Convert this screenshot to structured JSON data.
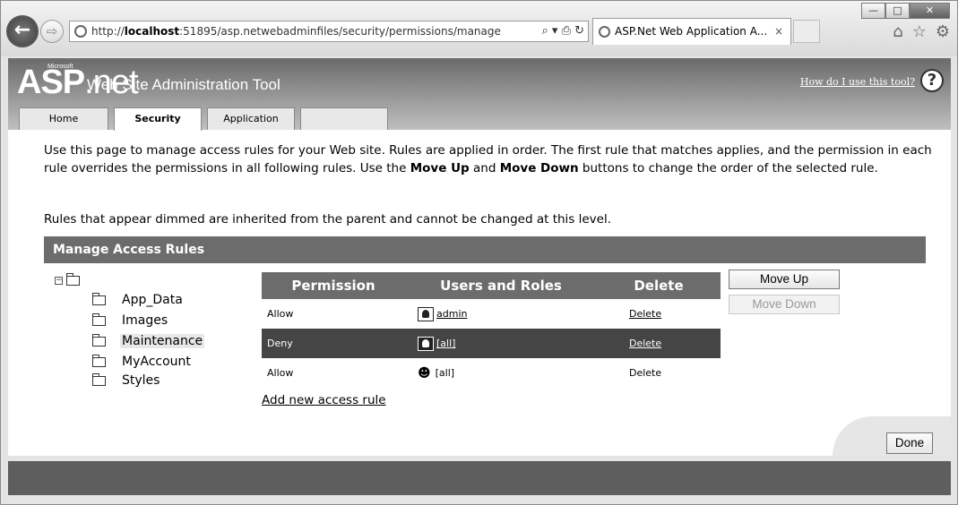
{
  "browser": {
    "address_prefix": "http://",
    "address_host": "localhost",
    "address_rest": ":51895/asp.netwebadminfiles/security/permissions/manage",
    "tab_title": "ASP.Net Web Application A...",
    "tab_close": "×",
    "window_buttons": [
      "—",
      "□",
      "✕"
    ],
    "address_tools": "⌕ ▾ ⎙ ↻"
  },
  "banner": {
    "logo_asp": "ASP",
    "logo_net": ".net",
    "logo_ms": "Microsoft",
    "title": "Web Site Administration Tool",
    "help_link": "How do I use this tool?",
    "help_icon": "?"
  },
  "tabs": [
    "Home",
    "Security",
    "Application",
    ""
  ],
  "active_tab": "Security",
  "intro": {
    "p1_a": "Use this page to manage access rules for your Web site. Rules are applied in order. The first rule that matches applies, and the permission in each rule overrides the permissions in all following rules. Use the ",
    "p1_move_up": "Move Up",
    "p1_and": " and ",
    "p1_move_down": "Move Down",
    "p1_b": " buttons to change the order of the selected rule.",
    "note": "Rules that appear dimmed are inherited from the parent and cannot be changed at this level."
  },
  "section_title": "Manage Access Rules",
  "tree": {
    "collapse": "−",
    "folders": [
      "App_Data",
      "Images",
      "Maintenance",
      "MyAccount",
      "Styles"
    ],
    "selected": "Maintenance"
  },
  "rules": {
    "headers": [
      "Permission",
      "Users and Roles",
      "Delete"
    ],
    "rows": [
      {
        "permission": "Allow",
        "user": "admin",
        "delete": "Delete",
        "selected": false,
        "inherited": false
      },
      {
        "permission": "Deny",
        "user": "[all]",
        "delete": "Delete",
        "selected": true,
        "inherited": false
      },
      {
        "permission": "Allow",
        "user": "[all]",
        "delete": "Delete",
        "selected": false,
        "inherited": true
      }
    ],
    "add_link": "Add new access rule"
  },
  "buttons": {
    "move_up": "Move Up",
    "move_down": "Move Down",
    "done": "Done"
  }
}
